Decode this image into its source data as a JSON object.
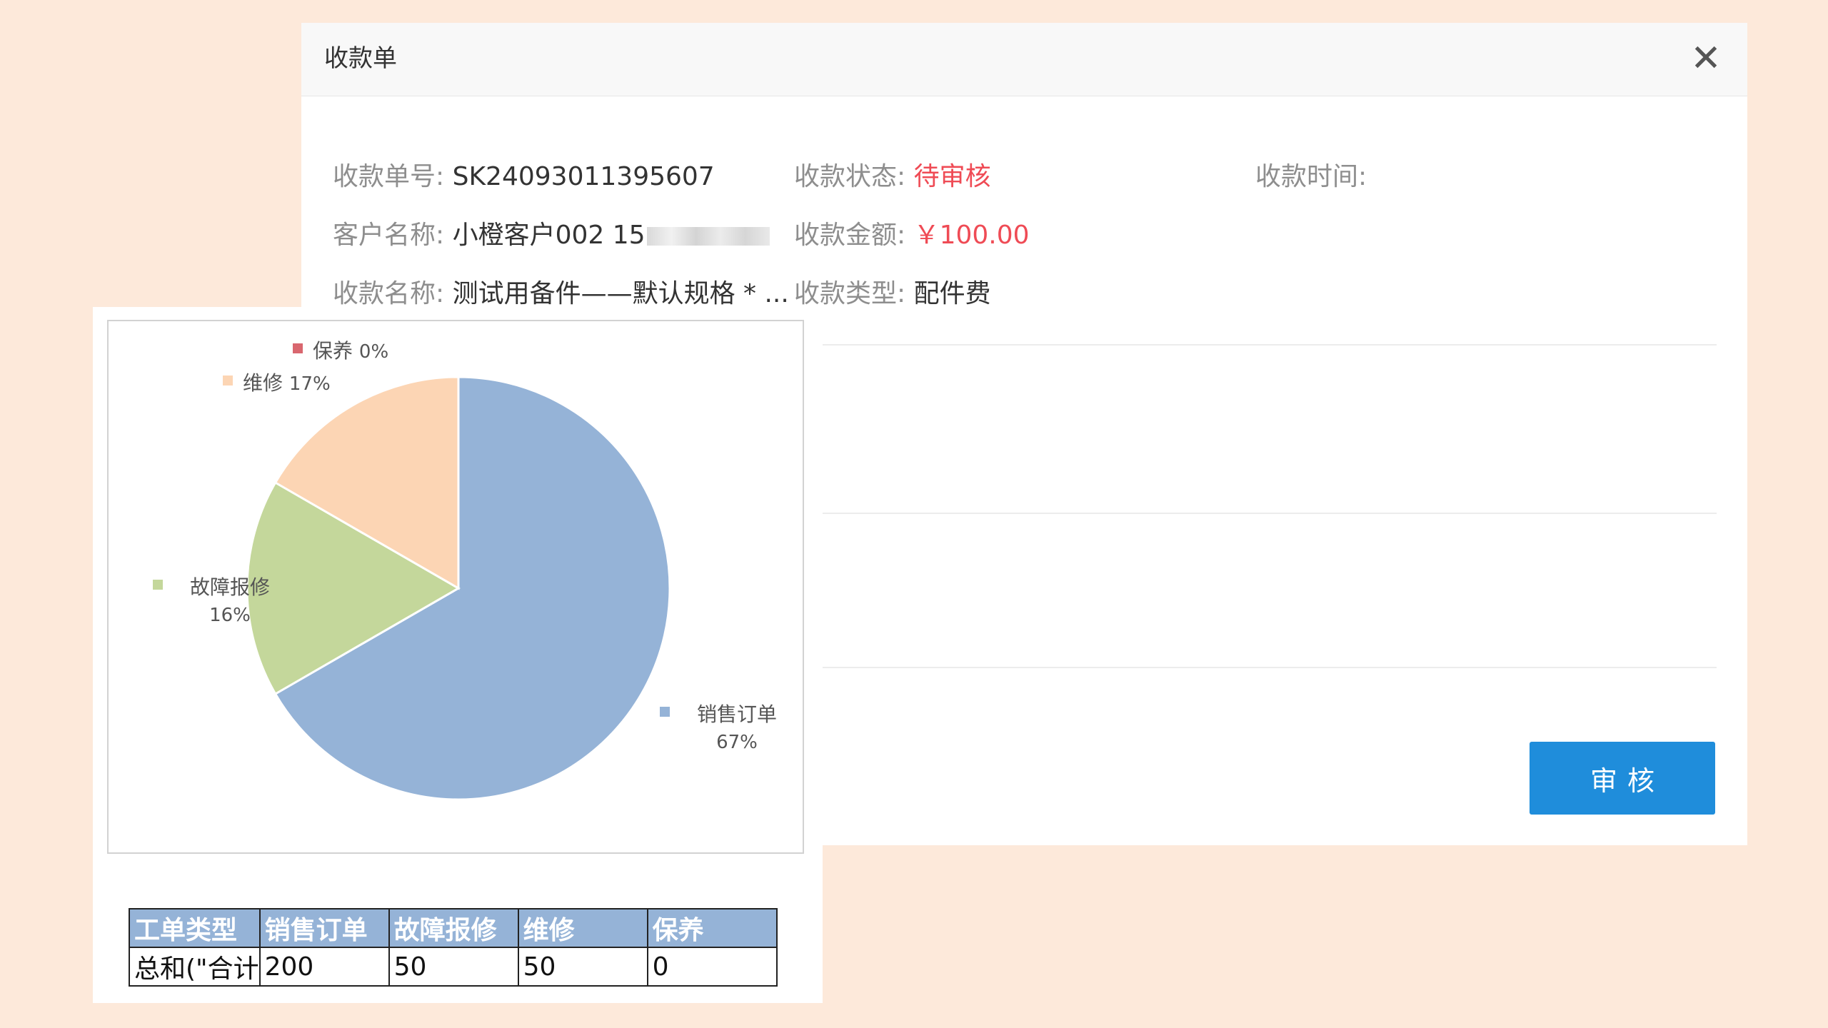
{
  "dialog": {
    "title": "收款单",
    "close_symbol": "✕",
    "fields": {
      "order_no_label": "收款单号:",
      "order_no_value": "SK24093011395607",
      "status_label": "收款状态:",
      "status_value": "待审核",
      "time_label": "收款时间:",
      "customer_label": "客户名称:",
      "customer_value": "小橙客户002 15",
      "amount_label": "收款金额:",
      "amount_value": "￥100.00",
      "name_label": "收款名称:",
      "name_value": "测试用备件——默认规格 * ...",
      "type_label": "收款类型:",
      "type_value": "配件费"
    },
    "audit_button": "审核"
  },
  "chart_data": {
    "type": "pie",
    "categories": [
      "销售订单",
      "故障报修",
      "维修",
      "保养"
    ],
    "values": [
      200,
      50,
      50,
      0
    ],
    "percent_labels": [
      "67%",
      "16%",
      "17%",
      "0%"
    ],
    "colors": [
      "#95b3d7",
      "#c4d79b",
      "#fcd5b4",
      "#d9676f"
    ]
  },
  "table": {
    "headers": [
      "工单类型",
      "销售订单",
      "故障报修",
      "维修",
      "保养"
    ],
    "row": [
      "总和(\"合计",
      "200",
      "50",
      "50",
      "0"
    ]
  }
}
